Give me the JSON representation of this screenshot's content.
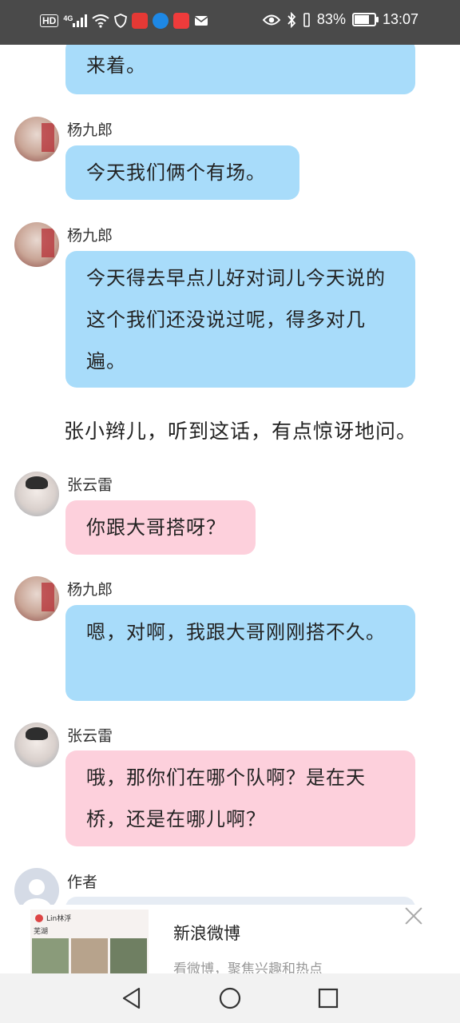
{
  "status_bar": {
    "network": "HD",
    "signal_type": "4G",
    "battery_percent": "83%",
    "battery_level": 0.83,
    "time": "13:07",
    "icons": [
      "wifi-icon",
      "shield-icon",
      "app-icon-red",
      "app-icon-blue",
      "app-icon-red2",
      "mail-icon",
      "eye-icon",
      "bluetooth-icon",
      "vibrate-icon",
      "battery-icon"
    ]
  },
  "chat": {
    "messages": [
      {
        "speaker": "",
        "text": "来着。",
        "style": "blue"
      },
      {
        "speaker": "杨九郎",
        "text": "今天我们俩个有场。",
        "style": "blue"
      },
      {
        "speaker": "杨九郎",
        "text": "今天得去早点儿好对词儿今天说的这个我们还没说过呢，得多对几遍。",
        "style": "blue"
      },
      {
        "narration": "张小辫儿，听到这话，有点惊讶地问。"
      },
      {
        "speaker": "张云雷",
        "text": "你跟大哥搭呀？",
        "style": "pink"
      },
      {
        "speaker": "杨九郎",
        "text": "嗯，对啊，我跟大哥刚刚搭不久。",
        "style": "blue"
      },
      {
        "speaker": "张云雷",
        "text": "哦，那你们在哪个队啊？是在天桥，还是在哪儿啊？",
        "style": "pink"
      },
      {
        "speaker": "作者",
        "text": "",
        "style": "grey"
      }
    ]
  },
  "ad": {
    "thumb_user": "Lin林浮",
    "thumb_caption": "芜湖",
    "title": "新浪微博",
    "subtitle": "看微博，聚焦兴趣和热点"
  },
  "colors": {
    "status_bg": "#4a4a4a",
    "bubble_blue": "#a8dcfa",
    "bubble_pink": "#fdd0dc",
    "nav_bg": "#f2f2f2"
  }
}
